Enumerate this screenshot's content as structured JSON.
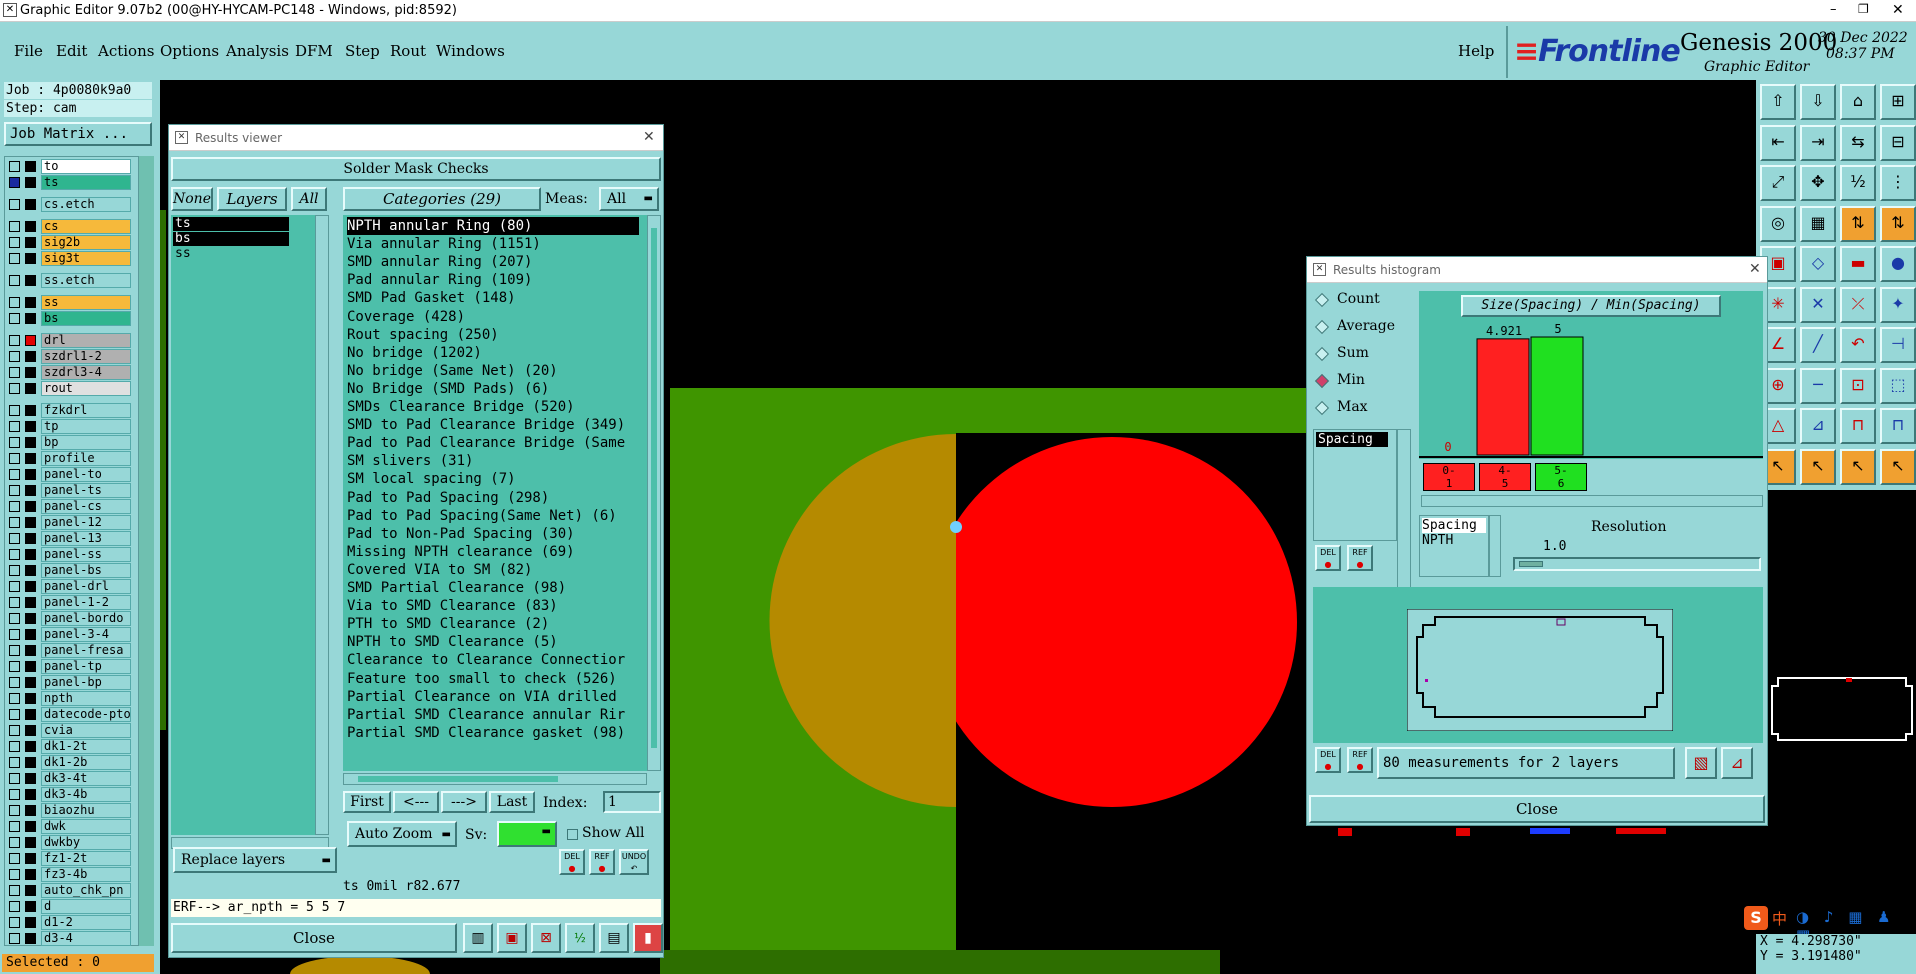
{
  "window": {
    "title": "Graphic Editor 9.07b2 (00@HY-HYCAM-PC148 - Windows, pid:8592)",
    "min": "–",
    "max": "❐",
    "close": "✕"
  },
  "menu": [
    "File",
    "Edit",
    "Actions",
    "Options",
    "Analysis",
    "DFM",
    "Step",
    "Rout",
    "Windows"
  ],
  "help": "Help",
  "brand": {
    "logo": "Frontline",
    "product": "Genesis 2000",
    "subtitle": "Graphic Editor",
    "date": "30 Dec 2022",
    "time": "08:37 PM"
  },
  "job": {
    "job": "Job : 4p0080k9a0",
    "step": "Step: cam",
    "matrix": "Job Matrix ..."
  },
  "layers": [
    {
      "name": "to",
      "color": "#ffffff",
      "sel": false
    },
    {
      "name": "ts",
      "color": "#2fb58f",
      "sel": true
    },
    {
      "name": "cs.etch",
      "color": "#97d7d7",
      "sel": false
    },
    {
      "name": "cs",
      "color": "#f6b93b",
      "sel": false
    },
    {
      "name": "sig2b",
      "color": "#f6b93b",
      "sel": false
    },
    {
      "name": "sig3t",
      "color": "#f6b93b",
      "sel": false
    },
    {
      "name": "ss.etch",
      "color": "#97d7d7",
      "sel": false
    },
    {
      "name": "ss",
      "color": "#f6b93b",
      "sel": false
    },
    {
      "name": "bs",
      "color": "#2fb58f",
      "sel": false
    },
    {
      "name": "drl",
      "color": "#b0b0b0",
      "sel": false
    },
    {
      "name": "szdrl1-2",
      "color": "#b0b0b0",
      "sel": false
    },
    {
      "name": "szdrl3-4",
      "color": "#b0b0b0",
      "sel": false
    },
    {
      "name": "rout",
      "color": "#e0e0e0",
      "sel": false
    },
    {
      "name": "fzkdrl",
      "color": "#97d7d7",
      "sel": false
    },
    {
      "name": "tp",
      "color": "#97d7d7",
      "sel": false
    },
    {
      "name": "bp",
      "color": "#97d7d7",
      "sel": false
    },
    {
      "name": "profile",
      "color": "#97d7d7",
      "sel": false
    },
    {
      "name": "panel-to",
      "color": "#97d7d7",
      "sel": false
    },
    {
      "name": "panel-ts",
      "color": "#97d7d7",
      "sel": false
    },
    {
      "name": "panel-cs",
      "color": "#97d7d7",
      "sel": false
    },
    {
      "name": "panel-12",
      "color": "#97d7d7",
      "sel": false
    },
    {
      "name": "panel-13",
      "color": "#97d7d7",
      "sel": false
    },
    {
      "name": "panel-ss",
      "color": "#97d7d7",
      "sel": false
    },
    {
      "name": "panel-bs",
      "color": "#97d7d7",
      "sel": false
    },
    {
      "name": "panel-drl",
      "color": "#97d7d7",
      "sel": false
    },
    {
      "name": "panel-1-2",
      "color": "#97d7d7",
      "sel": false
    },
    {
      "name": "panel-bordo",
      "color": "#97d7d7",
      "sel": false
    },
    {
      "name": "panel-3-4",
      "color": "#97d7d7",
      "sel": false
    },
    {
      "name": "panel-fresa",
      "color": "#97d7d7",
      "sel": false
    },
    {
      "name": "panel-tp",
      "color": "#97d7d7",
      "sel": false
    },
    {
      "name": "panel-bp",
      "color": "#97d7d7",
      "sel": false
    },
    {
      "name": "npth",
      "color": "#97d7d7",
      "sel": false
    },
    {
      "name": "datecode-pto",
      "color": "#97d7d7",
      "sel": false
    },
    {
      "name": "cvia",
      "color": "#97d7d7",
      "sel": false
    },
    {
      "name": "dk1-2t",
      "color": "#97d7d7",
      "sel": false
    },
    {
      "name": "dk1-2b",
      "color": "#97d7d7",
      "sel": false
    },
    {
      "name": "dk3-4t",
      "color": "#97d7d7",
      "sel": false
    },
    {
      "name": "dk3-4b",
      "color": "#97d7d7",
      "sel": false
    },
    {
      "name": "biaozhu",
      "color": "#97d7d7",
      "sel": false
    },
    {
      "name": "dwk",
      "color": "#97d7d7",
      "sel": false
    },
    {
      "name": "dwkby",
      "color": "#97d7d7",
      "sel": false
    },
    {
      "name": "fz1-2t",
      "color": "#97d7d7",
      "sel": false
    },
    {
      "name": "fz3-4b",
      "color": "#97d7d7",
      "sel": false
    },
    {
      "name": "auto_chk_pn",
      "color": "#97d7d7",
      "sel": false
    },
    {
      "name": "d",
      "color": "#97d7d7",
      "sel": false
    },
    {
      "name": "d1-2",
      "color": "#97d7d7",
      "sel": false
    },
    {
      "name": "d3-4",
      "color": "#97d7d7",
      "sel": false
    }
  ],
  "selected": "Selected : 0",
  "results_viewer": {
    "title": "Results viewer",
    "header": "Solder Mask Checks",
    "none": "None",
    "layers_btn": "Layers",
    "all": "All",
    "categories_btn": "Categories (29)",
    "meas_label": "Meas:",
    "meas_value": "All",
    "layer_list": [
      "ts",
      "bs",
      "ss"
    ],
    "categories": [
      "NPTH annular Ring (80)",
      "Via annular Ring (1151)",
      "SMD annular Ring (207)",
      "Pad annular Ring (109)",
      "SMD Pad Gasket (148)",
      "Coverage (428)",
      "Rout spacing (250)",
      "No bridge (1202)",
      "No bridge (Same Net) (20)",
      "No Bridge (SMD Pads) (6)",
      "SMDs Clearance Bridge (520)",
      "SMD to Pad Clearance Bridge (349)",
      "Pad to Pad Clearance Bridge (Same",
      "SM slivers (31)",
      "SM local spacing (7)",
      "Pad to Pad Spacing (298)",
      "Pad to Pad Spacing(Same Net) (6)",
      "Pad to Non-Pad Spacing (30)",
      "Missing NPTH clearance (69)",
      "Covered VIA to SM (82)",
      "SMD Partial Clearance (98)",
      "Via to SMD Clearance (83)",
      "PTH to SMD Clearance (2)",
      "NPTH to SMD Clearance (5)",
      "Clearance to Clearance Connectior",
      "Feature too small to check (526)",
      "Partial Clearance on VIA drilled",
      "Partial SMD Clearance annular Rir",
      "Partial SMD Clearance gasket (98)"
    ],
    "nav": {
      "first": "First",
      "prev": "<---",
      "next": "--->",
      "last": "Last",
      "index_label": "Index:",
      "index_value": "1"
    },
    "auto_zoom": "Auto Zoom",
    "sv_label": "Sv:",
    "show_all": "Show All",
    "replace_layers": "Replace layers",
    "status": "ts 0mil   r82.677",
    "erf": "ERF--> ar_npth = 5 5 7",
    "close": "Close",
    "del": "DEL",
    "ref": "REF",
    "undo": "UNDO"
  },
  "histogram": {
    "title": "Results histogram",
    "options": [
      "Count",
      "Average",
      "Sum",
      "Min",
      "Max"
    ],
    "selected_option": "Min",
    "list_item": "Spacing",
    "chart_title": "Size(Spacing) / Min(Spacing)",
    "value_labels": [
      "0",
      "4.921",
      "5"
    ],
    "bin_labels": [
      [
        "0-",
        "1"
      ],
      [
        "4-",
        "5"
      ],
      [
        "5-",
        "6"
      ]
    ],
    "params": [
      "Spacing",
      "NPTH"
    ],
    "resolution_label": "Resolution",
    "resolution_value": "1.0",
    "del": "DEL",
    "ref": "REF",
    "summary": "80 measurements for 2 layers",
    "close": "Close"
  },
  "chart_data": {
    "type": "bar",
    "title": "Size(Spacing) / Min(Spacing)",
    "categories": [
      "0-1",
      "4-5",
      "5-6"
    ],
    "values": [
      0,
      4.921,
      5
    ],
    "colors": [
      "#ff2020",
      "#ff2020",
      "#20e020"
    ],
    "ylim": [
      0,
      5
    ]
  },
  "coords": {
    "x": "X = 4.298730\"",
    "y": "Y = 3.191480\""
  },
  "ime": {
    "logo": "S",
    "lang": "中"
  }
}
